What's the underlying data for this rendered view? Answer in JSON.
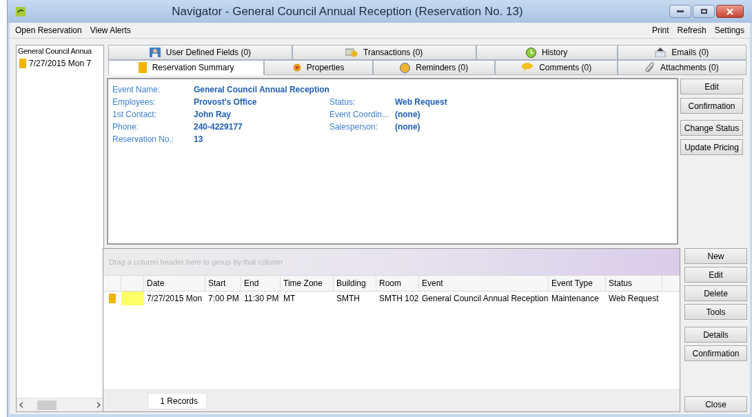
{
  "window": {
    "title": "Navigator - General Council Annual Reception (Reservation No. 13)"
  },
  "menu_left": [
    "Open Reservation",
    "View Alerts"
  ],
  "menu_right": [
    "Print",
    "Refresh",
    "Settings"
  ],
  "sidebar": {
    "header": "General Council Annua",
    "items": [
      {
        "label": "7/27/2015 Mon 7",
        "selected": false
      }
    ]
  },
  "tabs_row_1": [
    {
      "label": "User Defined Fields (0)",
      "selected": false
    },
    {
      "label": "Transactions (0)",
      "selected": false
    },
    {
      "label": "History",
      "selected": false
    },
    {
      "label": "Emails (0)",
      "selected": false
    }
  ],
  "tabs_row_2": [
    {
      "label": "Reservation Summary",
      "selected": true
    },
    {
      "label": "Properties",
      "selected": false
    },
    {
      "label": "Reminders (0)",
      "selected": false
    },
    {
      "label": "Comments (0)",
      "selected": false
    },
    {
      "label": "Attachments (0)",
      "selected": false
    }
  ],
  "summary": {
    "left": [
      {
        "label": "Event Name:",
        "value": "General Council Annual Reception"
      },
      {
        "label": "Employees:",
        "value": "Provost's Office"
      },
      {
        "label": "1st Contact:",
        "value": "John Ray"
      },
      {
        "label": "Phone:",
        "value": "240-4229177"
      },
      {
        "label": "Reservation No.:",
        "value": "13"
      }
    ],
    "right": [
      {
        "label": "Status:",
        "value": "Web Request"
      },
      {
        "label": "Event Coordin...",
        "value": "(none)"
      },
      {
        "label": "Salesperson:",
        "value": "(none)"
      }
    ]
  },
  "summary_buttons": [
    "Edit",
    "Confirmation",
    "Change Status",
    "Update Pricing"
  ],
  "grid": {
    "group_hint": "Drag a column header here to group by that column",
    "columns": [
      "Date",
      "Start",
      "End",
      "Time Zone",
      "Building",
      "Room",
      "Event",
      "Event Type",
      "Status"
    ],
    "rows": [
      {
        "color": "#ffff66",
        "cells": [
          "7/27/2015 Mon",
          "7:00 PM",
          "11:30 PM",
          "MT",
          "SMTH",
          "SMTH 102",
          "General Council Annual Reception",
          "Maintenance",
          "Web Request"
        ]
      }
    ],
    "footer": "1 Records"
  },
  "grid_buttons": [
    [
      "New",
      "Edit",
      "Delete",
      "Tools"
    ],
    [
      "Details",
      "Confirmation"
    ],
    [
      "Close"
    ]
  ]
}
